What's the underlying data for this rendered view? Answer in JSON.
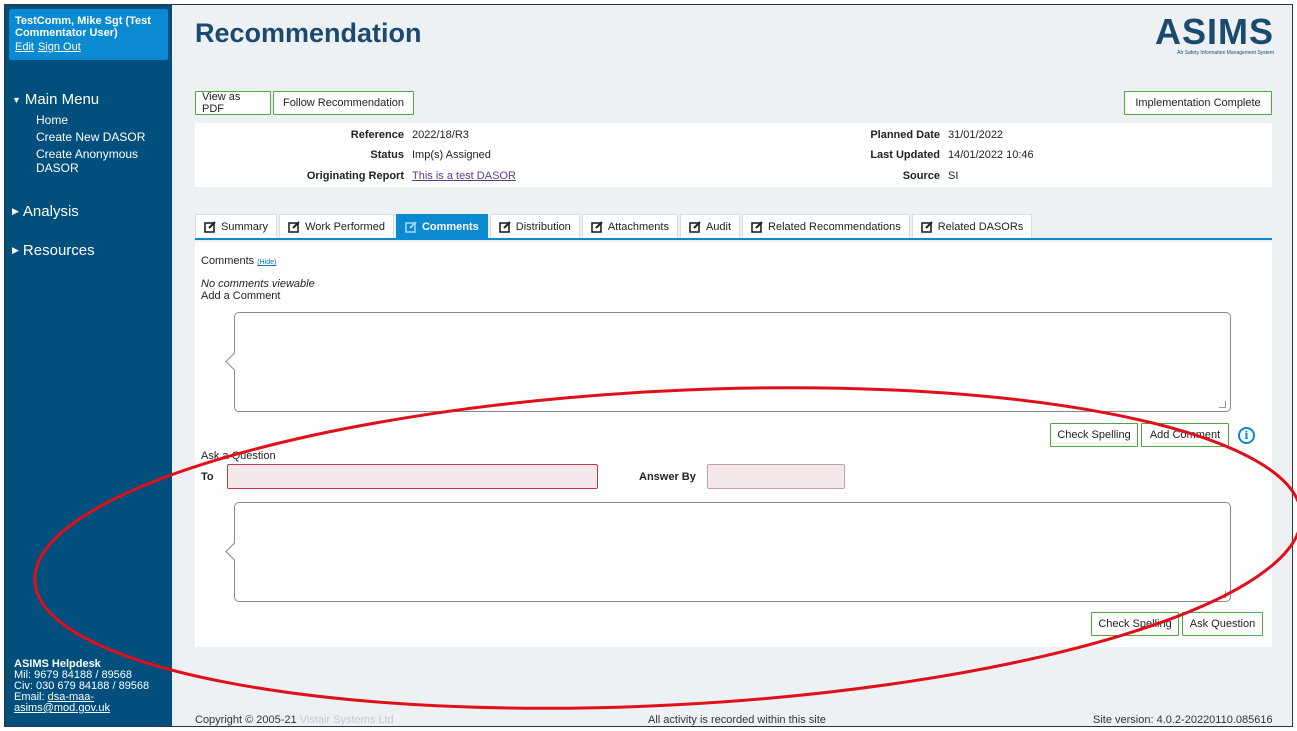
{
  "user": {
    "name": "TestComm, Mike Sgt (Test Commentator User)",
    "edit": "Edit",
    "signout": "Sign Out"
  },
  "menu": {
    "main": "Main Menu",
    "items": [
      "Home",
      "Create New DASOR",
      "Create Anonymous DASOR"
    ],
    "analysis": "Analysis",
    "resources": "Resources"
  },
  "helpdesk": {
    "title": "ASIMS Helpdesk",
    "mil": "Mil: 9679 84188 / 89568",
    "civ": "Civ: 030 679 84188 / 89568",
    "email_label": "Email:",
    "email": "dsa-maa-asims@mod.gov.uk"
  },
  "page": {
    "title": "Recommendation"
  },
  "logo": {
    "text": "ASIMS",
    "sub": "Air Safety Information Management System"
  },
  "toolbar": {
    "pdf": "View as PDF",
    "follow": "Follow Recommendation",
    "impl": "Implementation Complete"
  },
  "info": {
    "reference_label": "Reference",
    "reference": "2022/18/R3",
    "status_label": "Status",
    "status": "Imp(s) Assigned",
    "orig_label": "Originating Report",
    "orig": "This is a test DASOR",
    "planned_label": "Planned Date",
    "planned": "31/01/2022",
    "updated_label": "Last Updated",
    "updated": "14/01/2022 10:46",
    "source_label": "Source",
    "source": "SI"
  },
  "tabs": [
    "Summary",
    "Work Performed",
    "Comments",
    "Distribution",
    "Attachments",
    "Audit",
    "Related Recommendations",
    "Related DASORs"
  ],
  "comments": {
    "heading": "Comments",
    "hide": "(Hide)",
    "none": "No comments viewable",
    "add": "Add a Comment",
    "check": "Check Spelling",
    "add_btn": "Add Comment"
  },
  "question": {
    "heading": "Ask a Question",
    "to": "To",
    "answer_by": "Answer By",
    "check": "Check Spelling",
    "ask": "Ask Question"
  },
  "footer": {
    "copy": "Copyright © 2005-21",
    "vistair": "Vistair Systems Ltd",
    "notice": "All activity is recorded within this site",
    "version": "Site version: 4.0.2-20220110.085616"
  },
  "colors": {
    "sidebar": "#004f7c",
    "accent": "#0b8ad1",
    "button_border": "#4fa943",
    "annotation": "#e0101a"
  }
}
